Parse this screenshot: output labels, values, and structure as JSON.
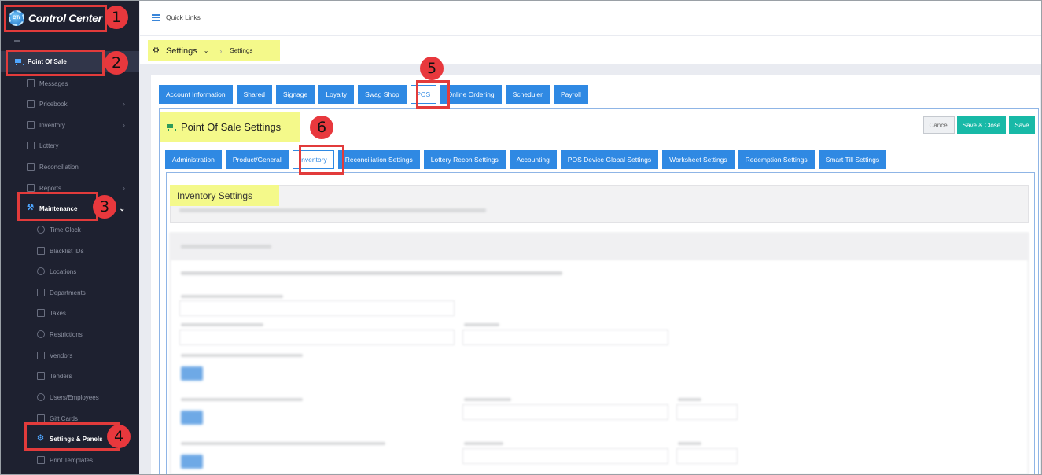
{
  "app": {
    "logo_text": "Control Center",
    "logo_badge": "CTr"
  },
  "sidebar": {
    "top_items": [
      {
        "label": "Point Of Sale",
        "icon": "cart-icon",
        "active": true
      },
      {
        "label": "Messages",
        "icon": "message-icon"
      },
      {
        "label": "Pricebook",
        "icon": "book-icon",
        "expandable": true
      },
      {
        "label": "Inventory",
        "icon": "chart-icon",
        "expandable": true
      },
      {
        "label": "Lottery",
        "icon": "ticket-icon"
      },
      {
        "label": "Reconciliation",
        "icon": "grid-icon"
      },
      {
        "label": "Reports",
        "icon": "chart-icon",
        "expandable": true
      },
      {
        "label": "Maintenance",
        "icon": "wrench-icon",
        "expanded": true
      }
    ],
    "sub_items": [
      {
        "label": "Time Clock",
        "icon": "clock-icon"
      },
      {
        "label": "Blacklist IDs",
        "icon": "id-card-icon"
      },
      {
        "label": "Locations",
        "icon": "location-pin-icon"
      },
      {
        "label": "Departments",
        "icon": "document-icon"
      },
      {
        "label": "Taxes",
        "icon": "dollar-icon"
      },
      {
        "label": "Restrictions",
        "icon": "ban-icon"
      },
      {
        "label": "Vendors",
        "icon": "truck-icon"
      },
      {
        "label": "Tenders",
        "icon": "money-icon"
      },
      {
        "label": "Users/Employees",
        "icon": "users-icon"
      },
      {
        "label": "Gift Cards",
        "icon": "gift-icon"
      },
      {
        "label": "Settings & Panels",
        "icon": "gear-icon",
        "active": true
      },
      {
        "label": "Print Templates",
        "icon": "print-icon"
      }
    ]
  },
  "topbar": {
    "quick_links": "Quick Links"
  },
  "breadcrumb": {
    "title": "Settings",
    "current": "Settings"
  },
  "main_tabs": [
    {
      "label": "Account Information"
    },
    {
      "label": "Shared"
    },
    {
      "label": "Signage"
    },
    {
      "label": "Loyalty"
    },
    {
      "label": "Swag Shop"
    },
    {
      "label": "POS",
      "active": true
    },
    {
      "label": "Online Ordering"
    },
    {
      "label": "Scheduler"
    },
    {
      "label": "Payroll"
    }
  ],
  "panel": {
    "title": "Point Of Sale Settings",
    "cancel_label": "Cancel",
    "save_close_label": "Save & Close",
    "save_label": "Save"
  },
  "sub_tabs": [
    {
      "label": "Administration"
    },
    {
      "label": "Product/General"
    },
    {
      "label": "Inventory",
      "active": true
    },
    {
      "label": "Reconciliation Settings"
    },
    {
      "label": "Lottery Recon Settings"
    },
    {
      "label": "Accounting"
    },
    {
      "label": "POS Device Global Settings"
    },
    {
      "label": "Worksheet Settings"
    },
    {
      "label": "Redemption Settings"
    },
    {
      "label": "Smart Till Settings"
    }
  ],
  "inventory": {
    "title": "Inventory Settings"
  },
  "callouts": [
    "1",
    "2",
    "3",
    "4",
    "5",
    "6"
  ],
  "colors": {
    "sidebar_bg": "#1e2130",
    "primary_blue": "#2f89e3",
    "teal": "#18b9a7",
    "highlight_yellow": "#f4f98a",
    "callout_red": "#e23b3b"
  }
}
